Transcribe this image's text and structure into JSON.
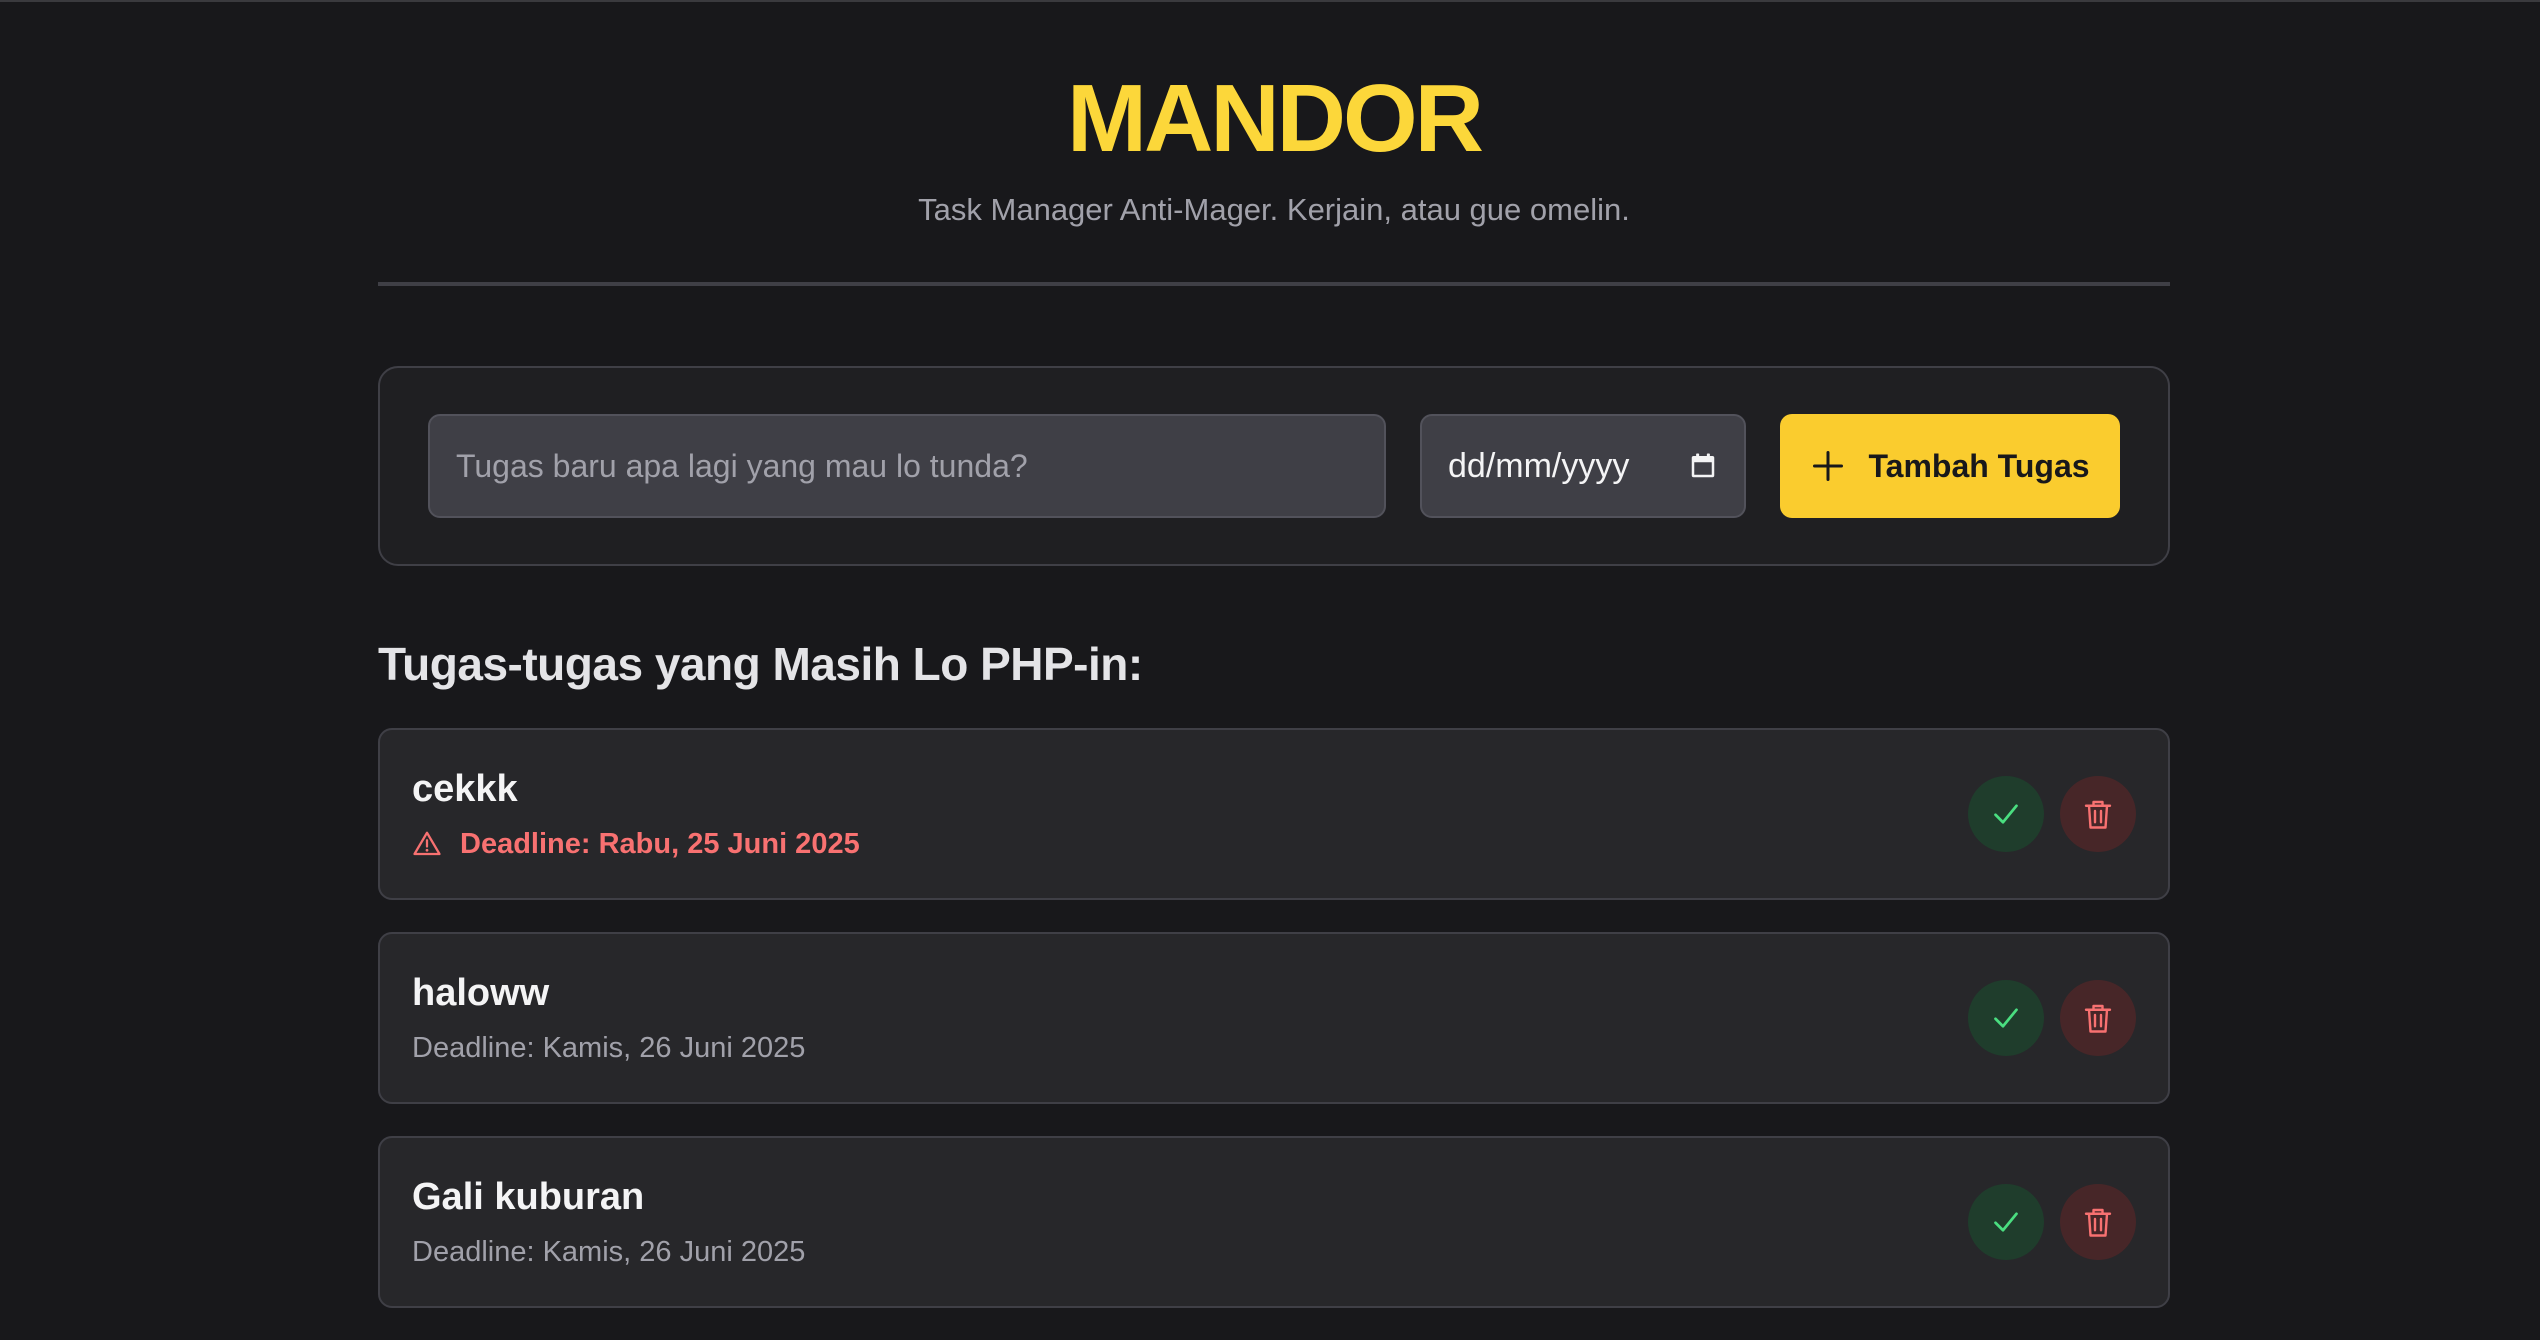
{
  "header": {
    "title": "MANDOR",
    "subtitle": "Task Manager Anti-Mager. Kerjain, atau gue omelin."
  },
  "form": {
    "task_placeholder": "Tugas baru apa lagi yang mau lo tunda?",
    "date_placeholder": "dd/mm/yyyy",
    "add_button_label": "Tambah Tugas",
    "add_button_color": "#facc2e"
  },
  "list": {
    "section_title": "Tugas-tugas yang Masih Lo PHP-in:",
    "tasks": [
      {
        "name": "cekkk",
        "deadline": "Deadline: Rabu, 25 Juni 2025",
        "overdue": true
      },
      {
        "name": "haloww",
        "deadline": "Deadline: Kamis, 26 Juni 2025",
        "overdue": false
      },
      {
        "name": "Gali kuburan",
        "deadline": "Deadline: Kamis, 26 Juni 2025",
        "overdue": false
      }
    ]
  },
  "icons": {
    "calendar": "calendar-icon",
    "plus": "plus-icon",
    "warning": "warning-icon",
    "check": "check-icon",
    "trash": "trash-icon"
  },
  "colors": {
    "accent": "#fcd73a",
    "background": "#18181b",
    "overdue": "#f87171",
    "complete": "#4ade80",
    "delete": "#f87171"
  }
}
